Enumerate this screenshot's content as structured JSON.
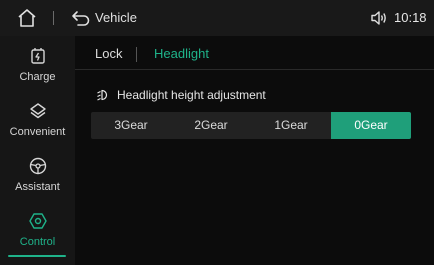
{
  "topbar": {
    "title": "Vehicle",
    "time": "10:18",
    "home_icon": "home-icon",
    "back_icon": "back-icon",
    "volume_icon": "volume-icon"
  },
  "sidebar": {
    "items": [
      {
        "label": "Charge",
        "icon": "charge-icon",
        "active": false
      },
      {
        "label": "Convenient",
        "icon": "convenient-icon",
        "active": false
      },
      {
        "label": "Assistant",
        "icon": "steering-wheel-icon",
        "active": false
      },
      {
        "label": "Control",
        "icon": "control-icon",
        "active": true
      }
    ]
  },
  "tabs": {
    "lock": "Lock",
    "headlight": "Headlight",
    "active": "Headlight"
  },
  "headlight": {
    "section_title": "Headlight height adjustment",
    "options": [
      "3Gear",
      "2Gear",
      "1Gear",
      "0Gear"
    ],
    "selected": "0Gear"
  },
  "colors": {
    "accent": "#1fb38a",
    "selected_bg": "#1f9f7a",
    "background": "#0c0c0c",
    "panel": "#161616"
  }
}
